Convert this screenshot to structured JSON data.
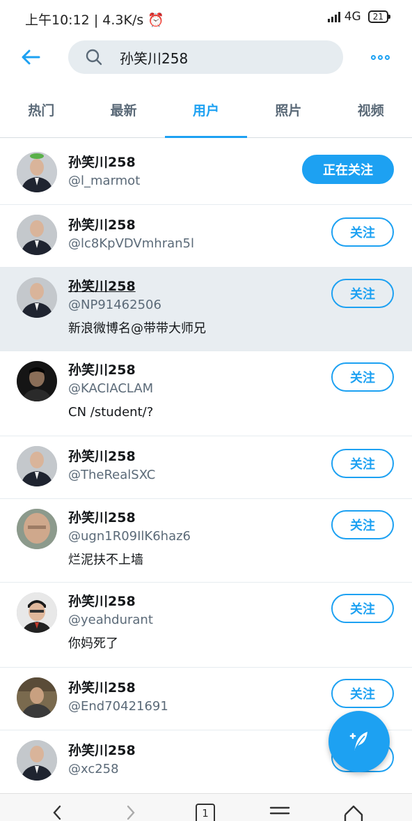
{
  "status": {
    "time": "上午10:12",
    "speed": "4.3K/s",
    "network": "4G",
    "battery": "21"
  },
  "search": {
    "query": "孙笑川258"
  },
  "tabs": [
    {
      "label": "热门"
    },
    {
      "label": "最新"
    },
    {
      "label": "用户",
      "active": true
    },
    {
      "label": "照片"
    },
    {
      "label": "视频"
    }
  ],
  "users": [
    {
      "name": "孙笑川258",
      "handle": "@l_marmot",
      "bio": "",
      "button": "正在关注",
      "following": true
    },
    {
      "name": "孙笑川258",
      "handle": "@lc8KpVDVmhran5l",
      "bio": "",
      "button": "关注"
    },
    {
      "name": "孙笑川258",
      "handle": "@NP91462506",
      "bio": "新浪微博名@带带大师兄",
      "button": "关注"
    },
    {
      "name": "孙笑川258",
      "handle": "@KACIACLAM",
      "bio": "CN /student/?",
      "button": "关注"
    },
    {
      "name": "孙笑川258",
      "handle": "@TheRealSXC",
      "bio": "",
      "button": "关注"
    },
    {
      "name": "孙笑川258",
      "handle": "@ugn1R09IlK6haz6",
      "bio": "烂泥扶不上墙",
      "button": "关注"
    },
    {
      "name": "孙笑川258",
      "handle": "@yeahdurant",
      "bio": "你妈死了",
      "button": "关注"
    },
    {
      "name": "孙笑川258",
      "handle": "@End70421691",
      "bio": "",
      "button": "关注"
    },
    {
      "name": "孙笑川258",
      "handle": "@xc258",
      "bio": "",
      "button": "关注"
    }
  ],
  "bottom_nav": {
    "tab_count": "1"
  },
  "icons": {
    "back": "arrow-left-icon",
    "search": "search-icon",
    "more": "more-dots-icon",
    "compose": "feather-compose-icon"
  },
  "colors": {
    "accent": "#1da1f2",
    "highlight_row": "#e8edf1"
  }
}
